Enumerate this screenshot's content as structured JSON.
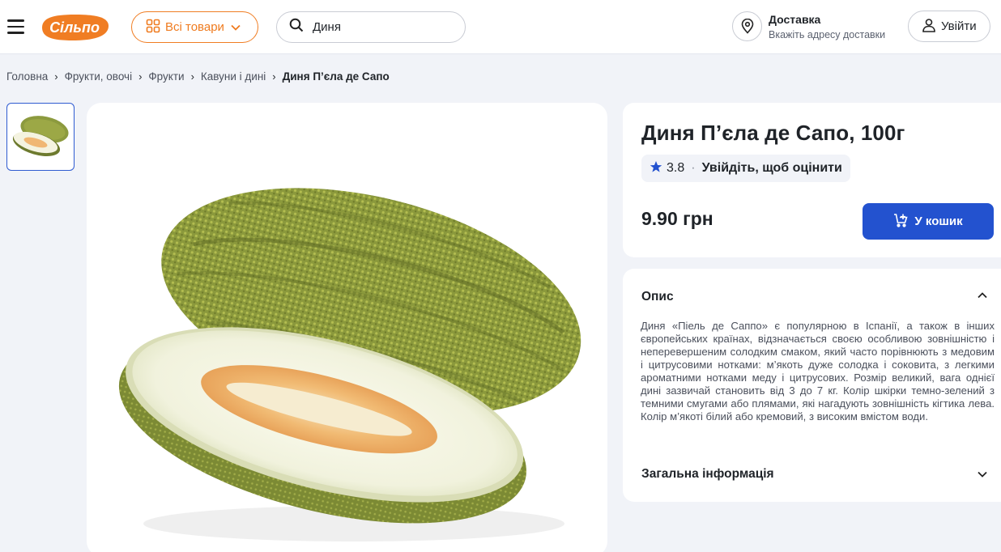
{
  "header": {
    "logo_text": "Сільпо",
    "all_products_label": "Всі товари",
    "search_value": "Диня",
    "delivery_title": "Доставка",
    "delivery_subtitle": "Вкажіть адресу доставки",
    "login_label": "Увійти"
  },
  "breadcrumb": [
    {
      "label": "Головна"
    },
    {
      "label": "Фрукти, овочі"
    },
    {
      "label": "Фрукти"
    },
    {
      "label": "Кавуни і дині"
    },
    {
      "label": "Диня П’єла де Сапо"
    }
  ],
  "product": {
    "title": "Диня П’єла де Сапо, 100г",
    "rating_value": "3.8",
    "rating_separator": "·",
    "rating_login": "Увійдіть, щоб оцінити",
    "price": "9.90 грн",
    "cart_label": "У кошик"
  },
  "description": {
    "heading": "Опис",
    "text": "Диня «Піель де Саппо» є популярною в Іспанії, а також в інших європейських країнах, відзначається своєю особливою зовнішністю і неперевершеним солодким смаком, який часто порівнюють з медовим і цитрусовими нотками: м’якоть дуже солодка і соковита, з легкими ароматними нотками меду і цитрусових. Розмір великий, вага однієї дині зазвичай становить від 3 до 7 кг. Колір шкірки темно-зелений з темними смугами або плямами, які нагадують зовнішність кігтика лева. Колір м’якоті білий або кремовий, з високим вмістом води."
  },
  "general_info": {
    "heading": "Загальна інформація"
  },
  "colors": {
    "brand_orange": "#f07d23",
    "primary_blue": "#2352cf",
    "background": "#f1f3f8"
  },
  "icons": [
    "menu-icon",
    "grid-icon",
    "chevron-down-icon",
    "search-icon",
    "location-pin-icon",
    "user-icon",
    "star-icon",
    "cart-icon",
    "chevron-up-icon"
  ]
}
